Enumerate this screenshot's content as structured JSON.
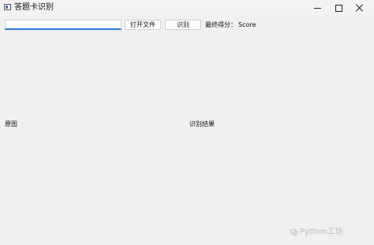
{
  "window": {
    "title": "答题卡识别",
    "controls": {
      "minimize": "minimize-icon",
      "maximize": "maximize-icon",
      "close": "close-icon"
    }
  },
  "toolbar": {
    "path_input_value": "",
    "open_file_label": "打开文件",
    "recognize_label": "识别",
    "score_label": "最终得分：",
    "score_value": "Score"
  },
  "panels": {
    "original_label": "原图",
    "result_label": "识别结果"
  },
  "watermark": {
    "text": "Python工坊"
  },
  "colors": {
    "background": "#f0f0f0",
    "input_focus_accent": "#2a7bd5"
  }
}
